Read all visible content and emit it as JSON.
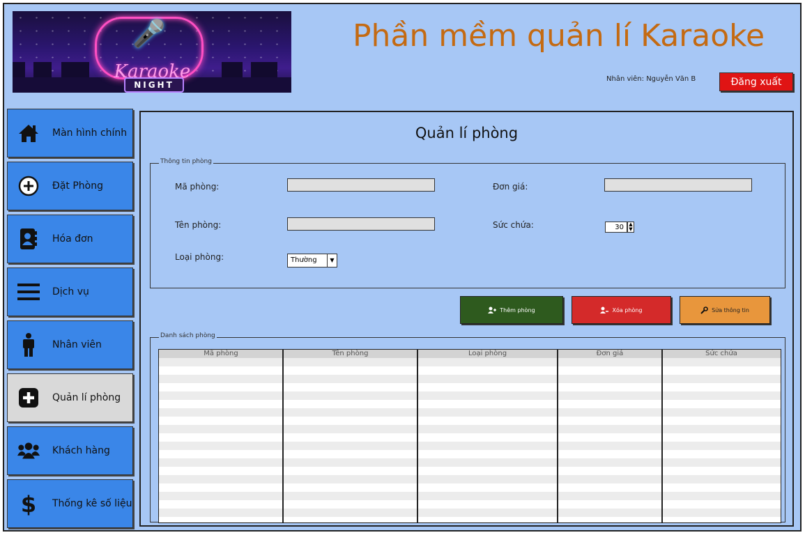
{
  "app": {
    "title": "Phần mềm quản lí Karaoke",
    "employee_label": "Nhân viên: Nguyễn Văn B",
    "logout_label": "Đăng xuất",
    "logo": {
      "script_text": "Karaoke",
      "night_text": "NIGHT"
    }
  },
  "sidebar": {
    "items": [
      {
        "label": "Màn hình chính",
        "icon": "home-icon"
      },
      {
        "label": "Đặt Phòng",
        "icon": "plus-circle-icon"
      },
      {
        "label": "Hóa đơn",
        "icon": "contact-book-icon"
      },
      {
        "label": "Dịch vụ",
        "icon": "menu-lines-icon"
      },
      {
        "label": "Nhân viên",
        "icon": "person-icon"
      },
      {
        "label": "Quản lí phòng",
        "icon": "plus-square-icon",
        "active": true
      },
      {
        "label": "Khách hàng",
        "icon": "users-icon"
      },
      {
        "label": "Thống kê số liệu",
        "icon": "dollar-icon"
      }
    ]
  },
  "main": {
    "title": "Quản lí phòng",
    "info_group": {
      "legend": "Thông tin phòng",
      "ma_phong_label": "Mã phòng:",
      "ma_phong_value": "",
      "don_gia_label": "Đơn giá:",
      "don_gia_value": "",
      "ten_phong_label": "Tên phòng:",
      "ten_phong_value": "",
      "suc_chua_label": "Sức chứa:",
      "suc_chua_value": "30",
      "loai_phong_label": "Loại phòng:",
      "loai_phong_value": "Thường"
    },
    "buttons": {
      "add": "Thêm phòng",
      "delete": "Xóa phòng",
      "edit": "Sửa thông tin"
    },
    "list_group": {
      "legend": "Danh sách phòng",
      "columns": [
        "Mã phòng",
        "Tên phòng",
        "Loại phòng",
        "Đơn giá",
        "Sức chứa"
      ],
      "rows": []
    }
  },
  "colors": {
    "background": "#a7c7f5",
    "sidebar_item": "#3a86e8",
    "sidebar_active": "#d9d9d9",
    "title": "#c46a12",
    "logout": "#e01414",
    "add_button": "#2e5a1e",
    "delete_button": "#d42a2a",
    "edit_button": "#e8963c"
  }
}
